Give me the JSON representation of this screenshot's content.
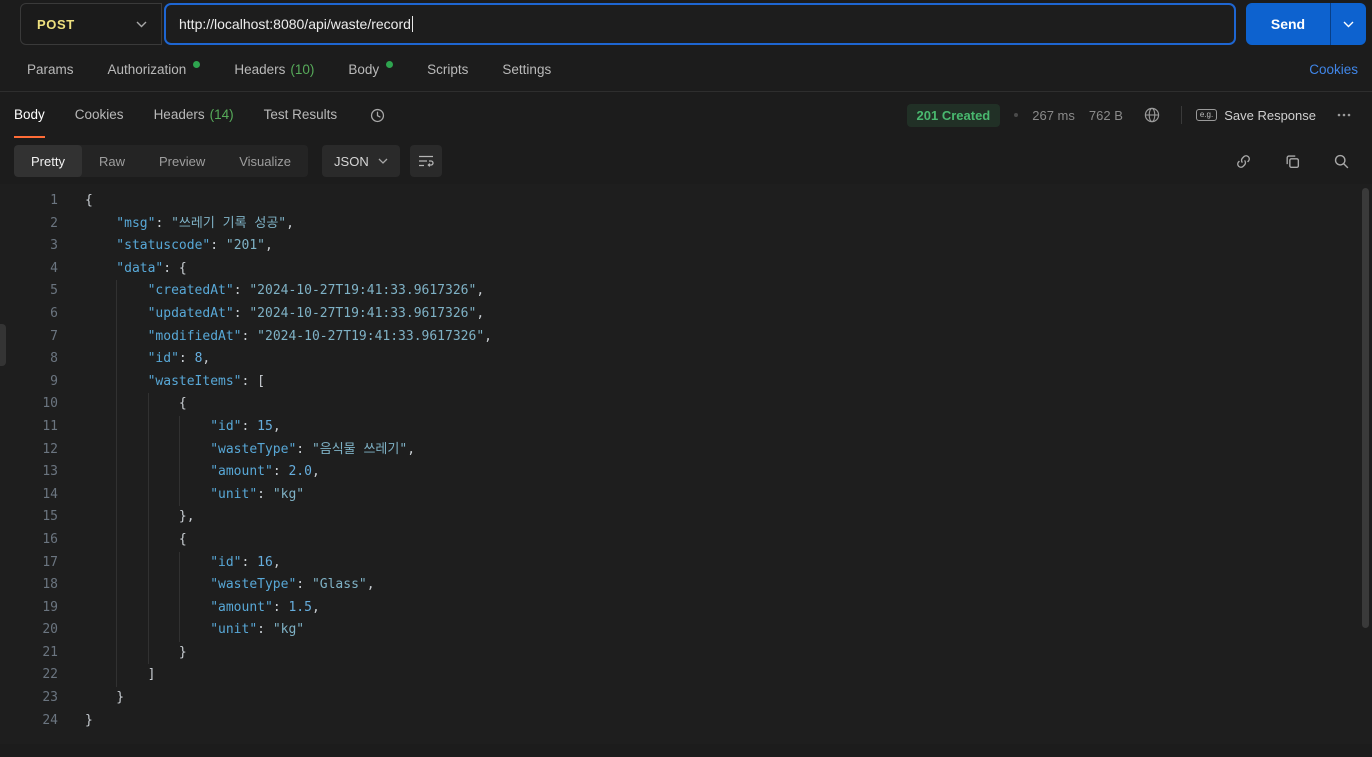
{
  "request_bar": {
    "method": "POST",
    "url": "http://localhost:8080/api/waste/record",
    "send_label": "Send"
  },
  "request_tabs": {
    "items": [
      {
        "label": "Params"
      },
      {
        "label": "Authorization",
        "dot": true
      },
      {
        "label": "Headers",
        "count": "(10)"
      },
      {
        "label": "Body",
        "dot": true
      },
      {
        "label": "Scripts"
      },
      {
        "label": "Settings"
      }
    ],
    "cookies_link": "Cookies"
  },
  "response_header": {
    "tabs": [
      {
        "label": "Body",
        "active": true
      },
      {
        "label": "Cookies"
      },
      {
        "label": "Headers",
        "count": "(14)"
      },
      {
        "label": "Test Results"
      }
    ],
    "status": "201 Created",
    "time": "267 ms",
    "size": "762 B",
    "save_response_prefix": "e.g.",
    "save_response": "Save Response"
  },
  "viewer_toolbar": {
    "modes": [
      "Pretty",
      "Raw",
      "Preview",
      "Visualize"
    ],
    "active_mode": "Pretty",
    "language": "JSON"
  },
  "icons": {
    "chevron-down": "v-shaped chevron",
    "history": "clock",
    "globe": "globe with meridians",
    "save-example": "e.g. boxed label",
    "more-options": "three dots",
    "link": "chain link",
    "copy": "two overlapping squares",
    "search": "magnifier",
    "wrap-line": "text lines"
  },
  "colors": {
    "accent": "#ff6c37",
    "method": "#eee07e",
    "send_blue": "#0d62cf",
    "focus_blue": "#1e66d2",
    "success": "#49b86f",
    "dot_green": "#2ea44f",
    "count_green": "#57ab5a",
    "link_blue": "#4086e8",
    "code_key": "#58a8d7",
    "code_string": "#7fb2c6",
    "code_number": "#66aede",
    "code_punct": "#c9ced3",
    "line_number": "#6b7580"
  },
  "code": {
    "lines": [
      {
        "i": 0,
        "t": [
          [
            "p",
            "{"
          ]
        ]
      },
      {
        "i": 1,
        "t": [
          [
            "k",
            "\"msg\""
          ],
          [
            "p",
            ": "
          ],
          [
            "s",
            "\"쓰레기 기록 성공\""
          ],
          [
            "p",
            ","
          ]
        ]
      },
      {
        "i": 1,
        "t": [
          [
            "k",
            "\"statuscode\""
          ],
          [
            "p",
            ": "
          ],
          [
            "s",
            "\"201\""
          ],
          [
            "p",
            ","
          ]
        ]
      },
      {
        "i": 1,
        "t": [
          [
            "k",
            "\"data\""
          ],
          [
            "p",
            ": {"
          ]
        ]
      },
      {
        "i": 2,
        "t": [
          [
            "k",
            "\"createdAt\""
          ],
          [
            "p",
            ": "
          ],
          [
            "s",
            "\"2024-10-27T19:41:33.9617326\""
          ],
          [
            "p",
            ","
          ]
        ]
      },
      {
        "i": 2,
        "t": [
          [
            "k",
            "\"updatedAt\""
          ],
          [
            "p",
            ": "
          ],
          [
            "s",
            "\"2024-10-27T19:41:33.9617326\""
          ],
          [
            "p",
            ","
          ]
        ]
      },
      {
        "i": 2,
        "t": [
          [
            "k",
            "\"modifiedAt\""
          ],
          [
            "p",
            ": "
          ],
          [
            "s",
            "\"2024-10-27T19:41:33.9617326\""
          ],
          [
            "p",
            ","
          ]
        ]
      },
      {
        "i": 2,
        "t": [
          [
            "k",
            "\"id\""
          ],
          [
            "p",
            ": "
          ],
          [
            "n",
            "8"
          ],
          [
            "p",
            ","
          ]
        ]
      },
      {
        "i": 2,
        "t": [
          [
            "k",
            "\"wasteItems\""
          ],
          [
            "p",
            ": ["
          ]
        ]
      },
      {
        "i": 3,
        "t": [
          [
            "p",
            "{"
          ]
        ]
      },
      {
        "i": 4,
        "t": [
          [
            "k",
            "\"id\""
          ],
          [
            "p",
            ": "
          ],
          [
            "n",
            "15"
          ],
          [
            "p",
            ","
          ]
        ]
      },
      {
        "i": 4,
        "t": [
          [
            "k",
            "\"wasteType\""
          ],
          [
            "p",
            ": "
          ],
          [
            "s",
            "\"음식물 쓰레기\""
          ],
          [
            "p",
            ","
          ]
        ]
      },
      {
        "i": 4,
        "t": [
          [
            "k",
            "\"amount\""
          ],
          [
            "p",
            ": "
          ],
          [
            "n",
            "2.0"
          ],
          [
            "p",
            ","
          ]
        ]
      },
      {
        "i": 4,
        "t": [
          [
            "k",
            "\"unit\""
          ],
          [
            "p",
            ": "
          ],
          [
            "s",
            "\"kg\""
          ]
        ]
      },
      {
        "i": 3,
        "t": [
          [
            "p",
            "},"
          ]
        ]
      },
      {
        "i": 3,
        "t": [
          [
            "p",
            "{"
          ]
        ]
      },
      {
        "i": 4,
        "t": [
          [
            "k",
            "\"id\""
          ],
          [
            "p",
            ": "
          ],
          [
            "n",
            "16"
          ],
          [
            "p",
            ","
          ]
        ]
      },
      {
        "i": 4,
        "t": [
          [
            "k",
            "\"wasteType\""
          ],
          [
            "p",
            ": "
          ],
          [
            "s",
            "\"Glass\""
          ],
          [
            "p",
            ","
          ]
        ]
      },
      {
        "i": 4,
        "t": [
          [
            "k",
            "\"amount\""
          ],
          [
            "p",
            ": "
          ],
          [
            "n",
            "1.5"
          ],
          [
            "p",
            ","
          ]
        ]
      },
      {
        "i": 4,
        "t": [
          [
            "k",
            "\"unit\""
          ],
          [
            "p",
            ": "
          ],
          [
            "s",
            "\"kg\""
          ]
        ]
      },
      {
        "i": 3,
        "t": [
          [
            "p",
            "}"
          ]
        ]
      },
      {
        "i": 2,
        "t": [
          [
            "p",
            "]"
          ]
        ]
      },
      {
        "i": 1,
        "t": [
          [
            "p",
            "}"
          ]
        ]
      },
      {
        "i": 0,
        "t": [
          [
            "p",
            "}"
          ]
        ]
      }
    ]
  }
}
